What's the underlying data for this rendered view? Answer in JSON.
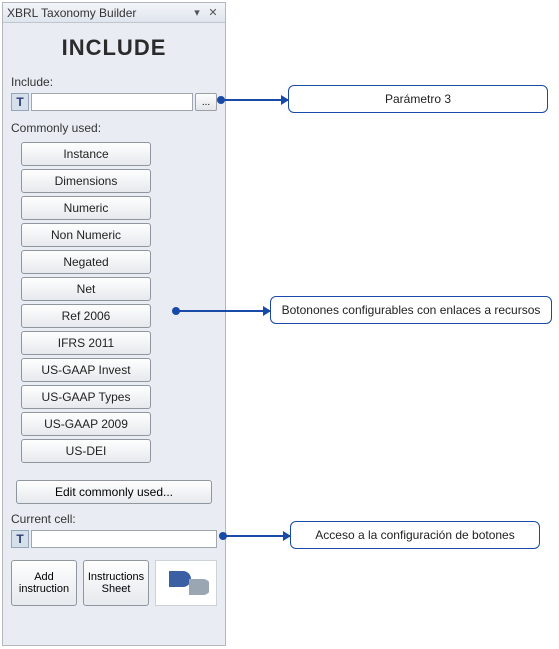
{
  "window": {
    "title": "XBRL Taxonomy Builder",
    "dropdown_icon": "▾",
    "close_icon": "✕"
  },
  "heading": "INCLUDE",
  "include": {
    "label": "Include:",
    "icon_text": "T",
    "value": "",
    "browse_label": "..."
  },
  "commonly_used": {
    "label": "Commonly used:",
    "buttons": [
      "Instance",
      "Dimensions",
      "Numeric",
      "Non Numeric",
      "Negated",
      "Net",
      "Ref 2006",
      "IFRS 2011",
      "US-GAAP Invest",
      "US-GAAP Types",
      "US-GAAP 2009",
      "US-DEI"
    ],
    "edit_label": "Edit commonly used..."
  },
  "current_cell": {
    "label": "Current cell:",
    "icon_text": "T",
    "value": ""
  },
  "bottom": {
    "add_instruction": "Add instruction",
    "instructions_sheet": "Instructions Sheet"
  },
  "callouts": {
    "c1": "Parámetro 3",
    "c2": "Botonones configurables con enlaces a recursos",
    "c3": "Acceso a la configuración de botones"
  }
}
